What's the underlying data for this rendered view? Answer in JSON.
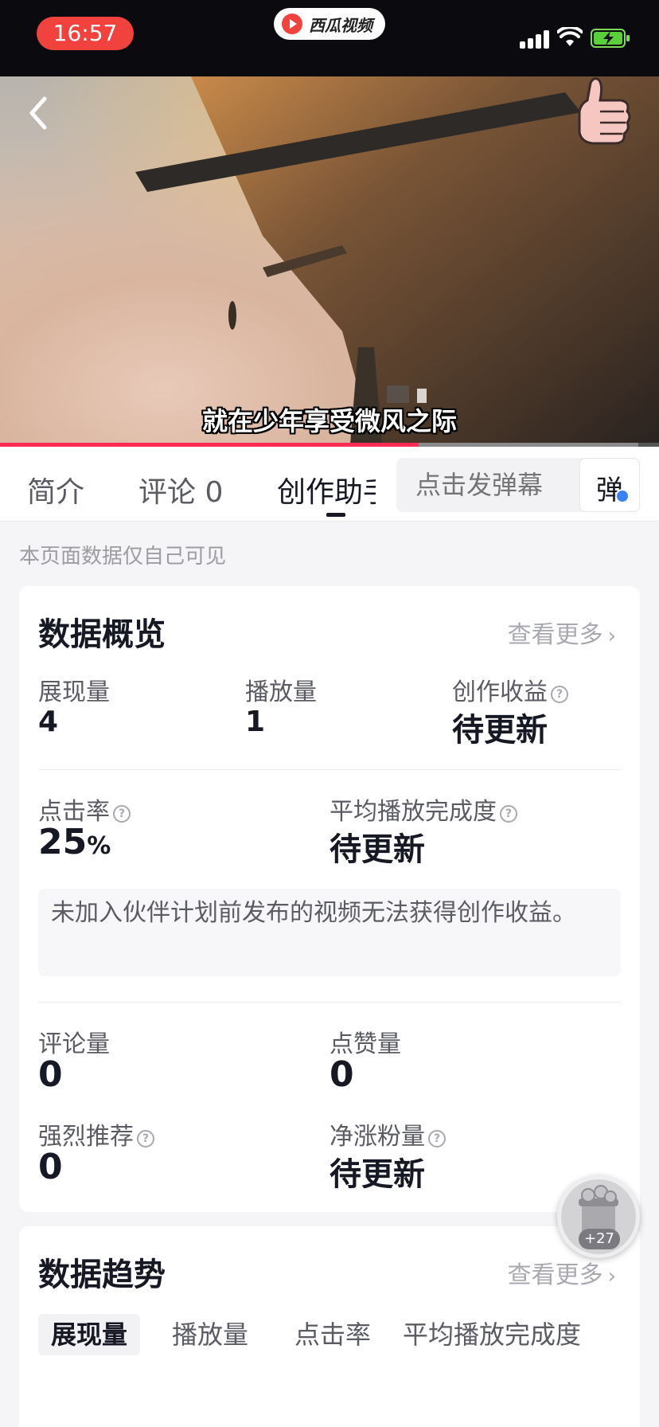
{
  "status_bar": {
    "time": "16:57",
    "app_name": "西瓜视频"
  },
  "video": {
    "subtitle": "就在少年享受微风之际",
    "progress_fraction": 0.635
  },
  "tabs": [
    {
      "label": "简介"
    },
    {
      "label": "评论 0"
    },
    {
      "label": "创作助手"
    }
  ],
  "danmaku": {
    "placeholder": "点击发弹幕",
    "toggle_label": "弹"
  },
  "privacy_note": "本页面数据仅自己可见",
  "overview": {
    "title": "数据概览",
    "see_more": "查看更多",
    "impressions": {
      "label": "展现量",
      "value": "4"
    },
    "plays": {
      "label": "播放量",
      "value": "1"
    },
    "earnings": {
      "label": "创作收益",
      "value": "待更新"
    },
    "ctr": {
      "label": "点击率",
      "value": "25",
      "unit": "%"
    },
    "completion": {
      "label": "平均播放完成度",
      "value": "待更新"
    },
    "notice": "未加入伙伴计划前发布的视频无法获得创作收益。",
    "comments": {
      "label": "评论量",
      "value": "0"
    },
    "likes": {
      "label": "点赞量",
      "value": "0"
    },
    "recommend": {
      "label": "强烈推荐",
      "value": "0"
    },
    "net_fans": {
      "label": "净涨粉量",
      "value": "待更新"
    }
  },
  "trend": {
    "title": "数据趋势",
    "see_more": "查看更多",
    "tabs": [
      {
        "label": "展现量"
      },
      {
        "label": "播放量"
      },
      {
        "label": "点击率"
      },
      {
        "label": "平均播放完成度"
      }
    ]
  },
  "float_widget": {
    "badge": "+27"
  }
}
